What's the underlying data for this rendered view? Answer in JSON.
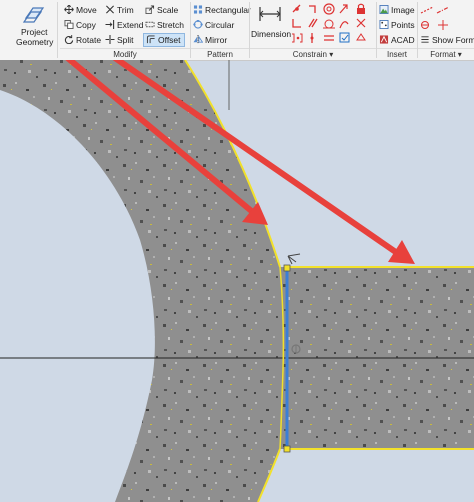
{
  "ribbon": {
    "project_geometry": {
      "line1": "Project",
      "line2": "Geometry"
    },
    "modify": {
      "label": "Modify",
      "move": "Move",
      "copy": "Copy",
      "rotate": "Rotate",
      "trim": "Trim",
      "extend": "Extend",
      "split": "Split",
      "scale": "Scale",
      "stretch": "Stretch",
      "offset": "Offset"
    },
    "pattern": {
      "label": "Pattern",
      "rectangular": "Rectangular",
      "circular": "Circular",
      "mirror": "Mirror"
    },
    "constrain": {
      "label": "Constrain ▾",
      "dimension": "Dimension"
    },
    "insert": {
      "label": "Insert",
      "image": "Image",
      "points": "Points",
      "acad": "ACAD"
    },
    "format": {
      "label": "Format ▾",
      "show_format": "Show Format"
    }
  },
  "colors": {
    "canvas_bg": "#cfd9e6",
    "part_fill": "#8f8f8f",
    "profile_yellow": "#f2e12a",
    "selected_line": "#3b7fd6",
    "arrow_red": "#e8413c",
    "accent_blue": "#1f6fc4"
  }
}
